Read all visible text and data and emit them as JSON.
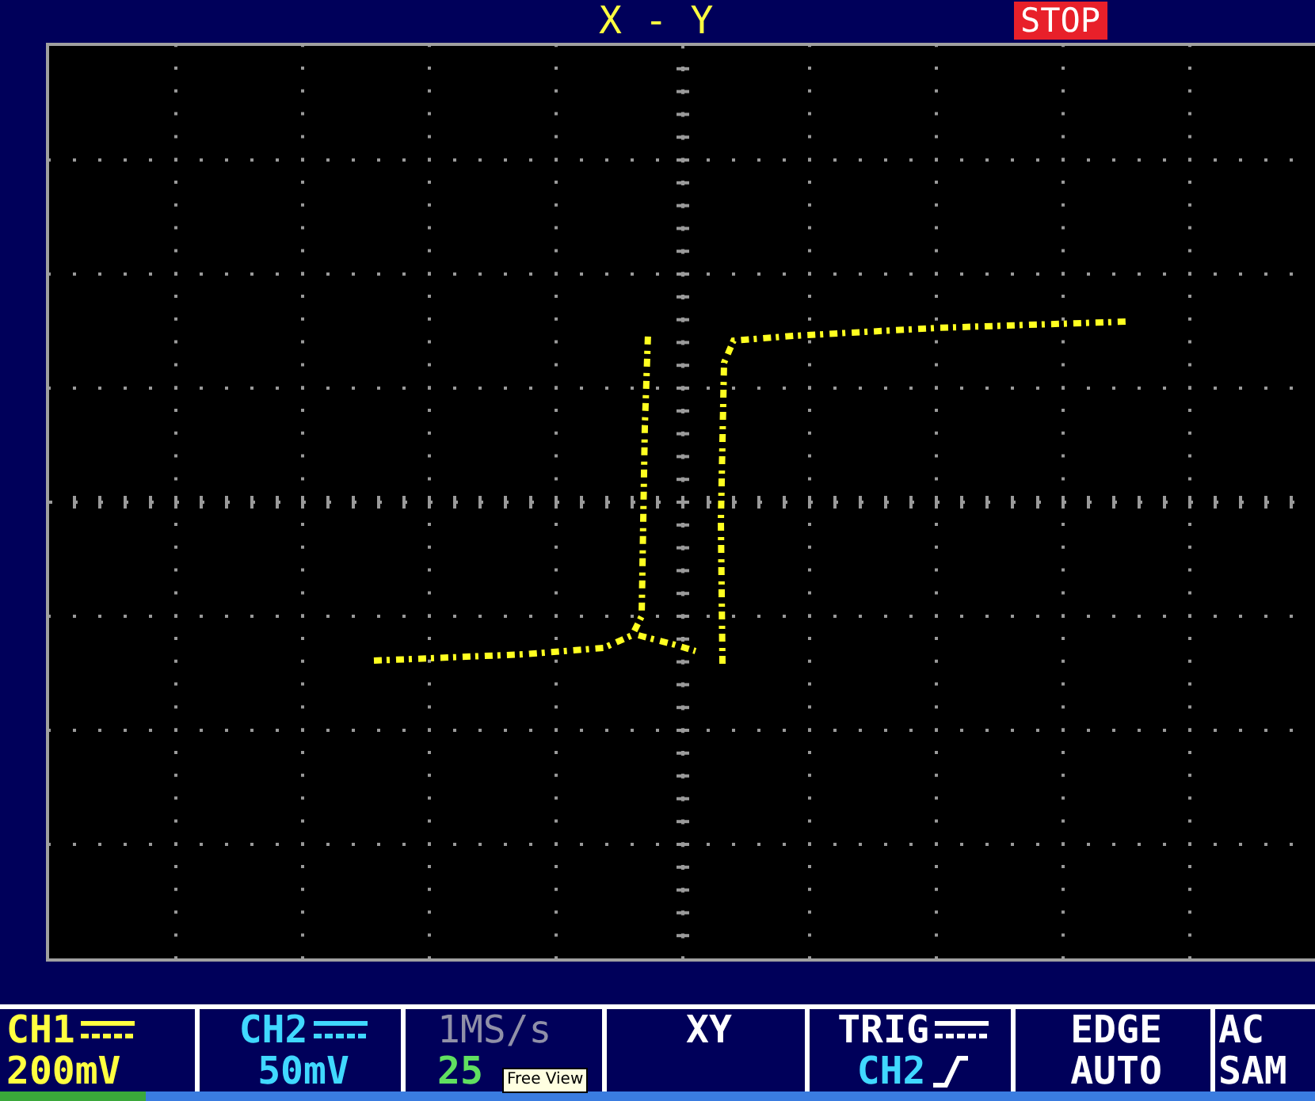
{
  "header": {
    "title": "X - Y",
    "run_state": "STOP"
  },
  "status_cells": [
    {
      "kind": "channel",
      "label": "CH1",
      "value": "200mV",
      "color": "#ffff40"
    },
    {
      "kind": "channel",
      "label": "CH2",
      "value": "50mV",
      "color": "#40d8ff"
    },
    {
      "kind": "timebase",
      "label": "1MS/s",
      "value": "25"
    },
    {
      "kind": "mode",
      "label": "XY"
    },
    {
      "kind": "trigger",
      "label": "TRIG",
      "value": "CH2",
      "color": "#40d8ff"
    },
    {
      "kind": "mode",
      "label": "EDGE",
      "value": "AUTO"
    },
    {
      "kind": "mode",
      "label": "AC",
      "value": "SAM"
    }
  ],
  "tooltip": "Free View"
}
